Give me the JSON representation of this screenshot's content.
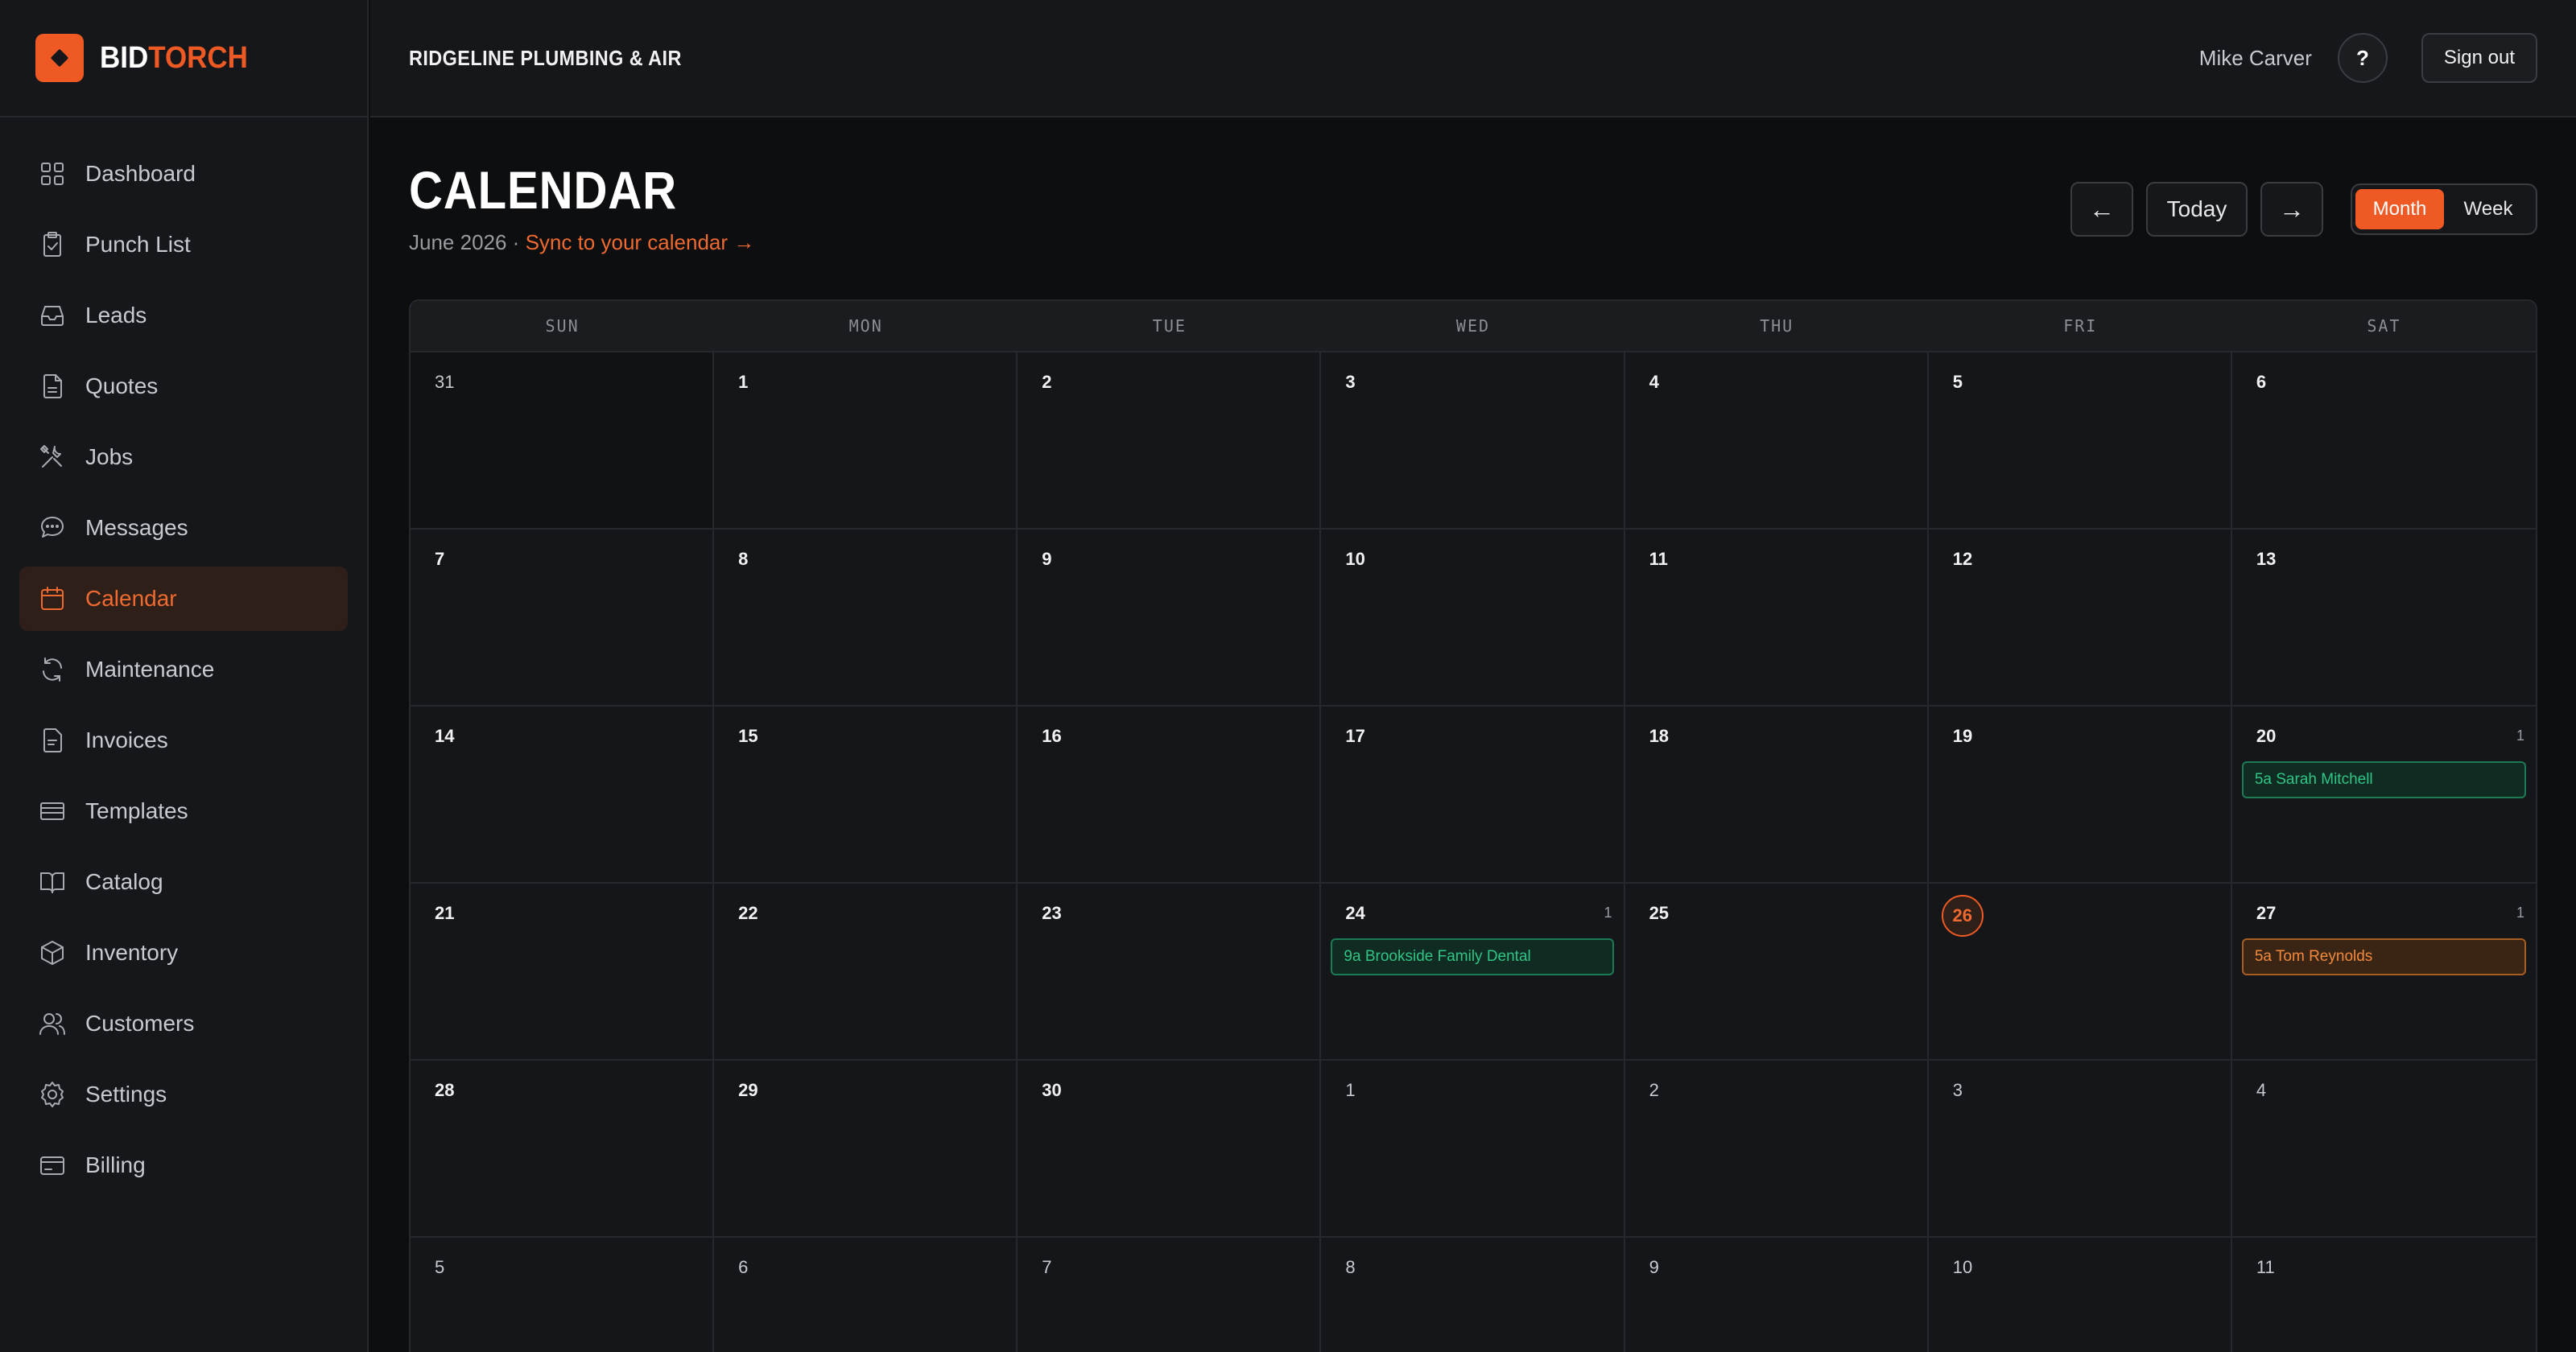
{
  "brand": {
    "part1": "BID",
    "part2": "TORCH",
    "accent": "#ef5a24"
  },
  "header": {
    "company": "RIDGELINE PLUMBING & AIR",
    "user": "Mike Carver",
    "help_label": "?",
    "signout_label": "Sign out"
  },
  "sidebar": {
    "items": [
      {
        "label": "Dashboard",
        "icon": "grid-icon",
        "active": false
      },
      {
        "label": "Punch List",
        "icon": "clipboard-check-icon",
        "active": false
      },
      {
        "label": "Leads",
        "icon": "inbox-icon",
        "active": false
      },
      {
        "label": "Quotes",
        "icon": "document-icon",
        "active": false
      },
      {
        "label": "Jobs",
        "icon": "tools-icon",
        "active": false
      },
      {
        "label": "Messages",
        "icon": "chat-bubble-icon",
        "active": false
      },
      {
        "label": "Calendar",
        "icon": "calendar-icon",
        "active": true
      },
      {
        "label": "Maintenance",
        "icon": "refresh-icon",
        "active": false
      },
      {
        "label": "Invoices",
        "icon": "invoice-icon",
        "active": false
      },
      {
        "label": "Templates",
        "icon": "template-icon",
        "active": false
      },
      {
        "label": "Catalog",
        "icon": "book-icon",
        "active": false
      },
      {
        "label": "Inventory",
        "icon": "box-icon",
        "active": false
      },
      {
        "label": "Customers",
        "icon": "users-icon",
        "active": false
      },
      {
        "label": "Settings",
        "icon": "gear-icon",
        "active": false
      },
      {
        "label": "Billing",
        "icon": "credit-card-icon",
        "active": false
      }
    ]
  },
  "page": {
    "title": "CALENDAR",
    "month": "June 2026 · ",
    "sync_link": "Sync to your calendar →",
    "prev_label": "←",
    "today_label": "Today",
    "next_label": "→",
    "view_month": "Month",
    "view_week": "Week"
  },
  "calendar": {
    "weekdays": [
      "SUN",
      "MON",
      "TUE",
      "WED",
      "THU",
      "FRI",
      "SAT"
    ],
    "days": [
      {
        "num": "31",
        "outside": true
      },
      {
        "num": "1"
      },
      {
        "num": "2"
      },
      {
        "num": "3"
      },
      {
        "num": "4"
      },
      {
        "num": "5"
      },
      {
        "num": "6"
      },
      {
        "num": "7"
      },
      {
        "num": "8"
      },
      {
        "num": "9"
      },
      {
        "num": "10"
      },
      {
        "num": "11"
      },
      {
        "num": "12"
      },
      {
        "num": "13"
      },
      {
        "num": "14"
      },
      {
        "num": "15"
      },
      {
        "num": "16"
      },
      {
        "num": "17"
      },
      {
        "num": "18"
      },
      {
        "num": "19"
      },
      {
        "num": "20",
        "count": "1",
        "event": {
          "label": "5a Sarah Mitchell",
          "color": "green"
        }
      },
      {
        "num": "21"
      },
      {
        "num": "22"
      },
      {
        "num": "23"
      },
      {
        "num": "24",
        "count": "1",
        "event": {
          "label": "9a Brookside Family Dental",
          "color": "green"
        }
      },
      {
        "num": "25"
      },
      {
        "num": "26",
        "today": true
      },
      {
        "num": "27",
        "count": "1",
        "event": {
          "label": "5a Tom Reynolds",
          "color": "orange"
        }
      },
      {
        "num": "28"
      },
      {
        "num": "29"
      },
      {
        "num": "30"
      },
      {
        "num": "1",
        "outside": true
      },
      {
        "num": "2",
        "outside": true
      },
      {
        "num": "3",
        "outside": true
      },
      {
        "num": "4",
        "outside": true
      },
      {
        "num": "5",
        "outside": true
      },
      {
        "num": "6",
        "outside": true
      },
      {
        "num": "7",
        "outside": true
      },
      {
        "num": "8",
        "outside": true
      },
      {
        "num": "9",
        "outside": true
      },
      {
        "num": "10",
        "outside": true
      },
      {
        "num": "11",
        "outside": true
      }
    ]
  }
}
